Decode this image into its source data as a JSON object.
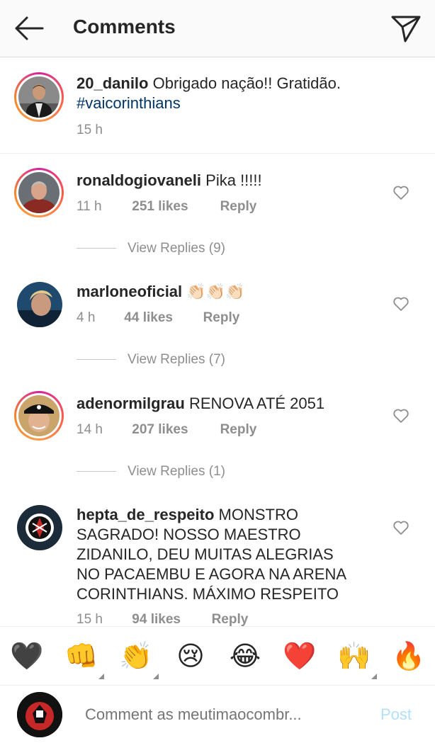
{
  "header": {
    "title": "Comments",
    "back_icon": "arrow-left-icon",
    "send_icon": "paper-plane-icon"
  },
  "caption": {
    "username": "20_danilo",
    "text": "Obrigado nação!! Gratidão.",
    "hashtag": "#vaicorinthians",
    "time": "15 h"
  },
  "comments": [
    {
      "username": "ronaldogiovaneli",
      "text": "Pika !!!!!",
      "time": "11 h",
      "likes": "251 likes",
      "reply": "Reply",
      "view_replies": "View Replies (9)"
    },
    {
      "username": "marloneoficial",
      "text": "👏🏻👏🏻👏🏻",
      "time": "4 h",
      "likes": "44 likes",
      "reply": "Reply",
      "view_replies": "View Replies (7)"
    },
    {
      "username": "adenormilgrau",
      "text": "RENOVA ATÉ 2051",
      "time": "14 h",
      "likes": "207 likes",
      "reply": "Reply",
      "view_replies": "View Replies (1)"
    },
    {
      "username": "hepta_de_respeito",
      "text_lines": [
        "MONSTRO",
        "SAGRADO! NOSSO MAESTRO",
        "ZIDANILO, DEU MUITAS ALEGRIAS",
        "NO PACAEMBU E AGORA NA ARENA",
        "CORINTHIANS. MÁXIMO RESPEITO"
      ],
      "time": "15 h",
      "likes": "94 likes",
      "reply": "Reply"
    }
  ],
  "reactions": [
    "🖤",
    "👊",
    "👏",
    "😢",
    "😂",
    "❤️",
    "🙌",
    "🔥"
  ],
  "composer": {
    "placeholder": "Comment as meutimaocombr...",
    "post_label": "Post"
  },
  "colors": {
    "link": "#003569",
    "muted": "#8e8e8e",
    "post_disabled": "#b2dffc"
  }
}
